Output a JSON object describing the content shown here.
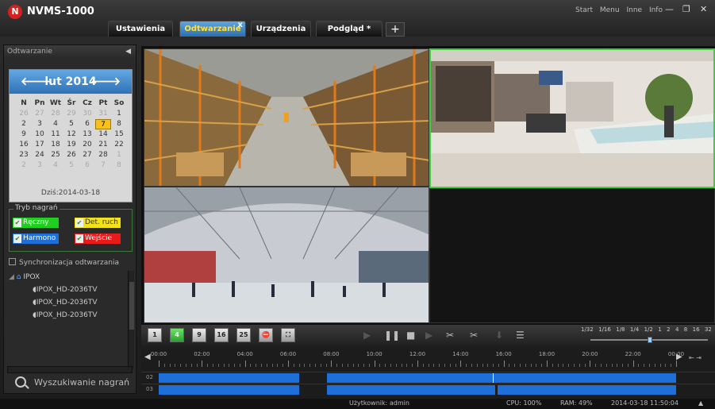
{
  "app": {
    "logo_letter": "N",
    "title": "NVMS-1000"
  },
  "tabs": [
    {
      "label": "Ustawienia"
    },
    {
      "label": "Odtwarzanie",
      "close": "x",
      "active": true
    },
    {
      "label": "Urządzenia"
    },
    {
      "label": "Podgląd *"
    }
  ],
  "tab_add": "+",
  "top_menu": [
    "Start",
    "Menu",
    "Inne",
    "Info"
  ],
  "window_controls": {
    "minimize": "—",
    "restore": "❐",
    "close": "✕"
  },
  "left_panel": {
    "title": "Odtwarzanie",
    "calendar": {
      "month_label": "lut 2014",
      "prev": "🡐",
      "next": "🡒",
      "weekdays": [
        "N",
        "Pn",
        "Wt",
        "Śr",
        "Cz",
        "Pt",
        "So"
      ],
      "weeks": [
        [
          {
            "d": "26",
            "dim": true
          },
          {
            "d": "27",
            "dim": true
          },
          {
            "d": "28",
            "dim": true
          },
          {
            "d": "29",
            "dim": true
          },
          {
            "d": "30",
            "dim": true
          },
          {
            "d": "31",
            "dim": true
          },
          {
            "d": "1"
          }
        ],
        [
          {
            "d": "2"
          },
          {
            "d": "3"
          },
          {
            "d": "4"
          },
          {
            "d": "5"
          },
          {
            "d": "6"
          },
          {
            "d": "7",
            "sel": true
          },
          {
            "d": "8"
          }
        ],
        [
          {
            "d": "9"
          },
          {
            "d": "10"
          },
          {
            "d": "11"
          },
          {
            "d": "12"
          },
          {
            "d": "13"
          },
          {
            "d": "14"
          },
          {
            "d": "15"
          }
        ],
        [
          {
            "d": "16"
          },
          {
            "d": "17"
          },
          {
            "d": "18"
          },
          {
            "d": "19"
          },
          {
            "d": "20"
          },
          {
            "d": "21"
          },
          {
            "d": "22"
          }
        ],
        [
          {
            "d": "23"
          },
          {
            "d": "24"
          },
          {
            "d": "25"
          },
          {
            "d": "26"
          },
          {
            "d": "27"
          },
          {
            "d": "28"
          },
          {
            "d": "1",
            "dim": true
          }
        ],
        [
          {
            "d": "2",
            "dim": true
          },
          {
            "d": "3",
            "dim": true
          },
          {
            "d": "4",
            "dim": true
          },
          {
            "d": "5",
            "dim": true
          },
          {
            "d": "6",
            "dim": true
          },
          {
            "d": "7",
            "dim": true
          },
          {
            "d": "8",
            "dim": true
          }
        ]
      ],
      "today": "Dziś:2014-03-18"
    },
    "rec_mode": {
      "legend": "Tryb nagrań",
      "items": [
        {
          "label": "Ręczny",
          "color": "#1fcf1f"
        },
        {
          "label": "Det. ruch",
          "color": "#f3e21a"
        },
        {
          "label": "Harmono",
          "color": "#1e6fd8"
        },
        {
          "label": "Wejście",
          "color": "#e81a1a"
        }
      ]
    },
    "sync_label": "Synchronizacja odtwarzania",
    "tree": {
      "root": "IPOX",
      "children": [
        "IPOX_HD-2036TV",
        "IPOX_HD-2036TV",
        "IPOX_HD-2036TV"
      ]
    },
    "search_label": "Wyszukiwanie nagrań"
  },
  "layout_buttons": [
    "1",
    "4",
    "9",
    "16",
    "25"
  ],
  "active_layout": "4",
  "speed": {
    "labels": [
      "1/32",
      "1/16",
      "1/8",
      "1/4",
      "1/2",
      "1",
      "2",
      "4",
      "8",
      "16",
      "32"
    ],
    "current": "1"
  },
  "timeline": {
    "hours": [
      "00:00",
      "02:00",
      "04:00",
      "06:00",
      "08:00",
      "10:00",
      "12:00",
      "14:00",
      "16:00",
      "18:00",
      "20:00",
      "22:00",
      "00:00"
    ],
    "rows": [
      {
        "label": "02",
        "segments": [
          [
            0,
            6.5
          ],
          [
            7.8,
            24
          ]
        ],
        "marker": 15.5
      },
      {
        "label": "03",
        "segments": [
          [
            0,
            6.5
          ],
          [
            7.8,
            15.6
          ],
          [
            15.7,
            24
          ]
        ]
      }
    ]
  },
  "status": {
    "user": "Użytkownik: admin",
    "cpu": "CPU: 100%",
    "ram": "RAM: 49%",
    "datetime": "2014-03-18 11:50:04",
    "up_arrow": "▲"
  }
}
